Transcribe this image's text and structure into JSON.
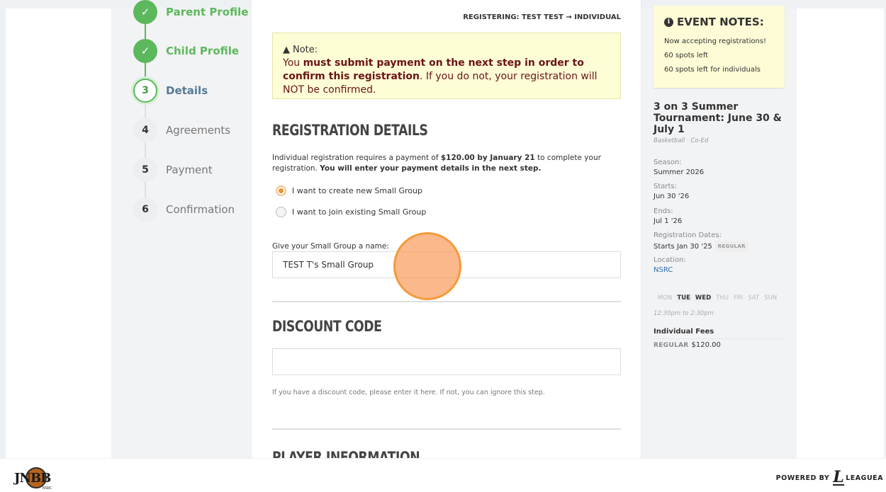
{
  "steps": [
    {
      "num": "✓",
      "label": "Parent Profile",
      "state": "done"
    },
    {
      "num": "✓",
      "label": "Child Profile",
      "state": "done"
    },
    {
      "num": "3",
      "label": "Details",
      "state": "current"
    },
    {
      "num": "4",
      "label": "Agreements",
      "state": "todo"
    },
    {
      "num": "5",
      "label": "Payment",
      "state": "todo"
    },
    {
      "num": "6",
      "label": "Confirmation",
      "state": "todo"
    }
  ],
  "main": {
    "registering": "REGISTERING: TEST TEST → INDIVIDUAL",
    "note": {
      "title": "Note:",
      "prefix": "You ",
      "bold": "must submit payment on the next step in order to confirm this registration",
      "suffix": ". If you do not, your registration will NOT be confirmed."
    },
    "registration_details": {
      "heading": "REGISTRATION DETAILS",
      "desc_1": "Individual registration requires a payment of ",
      "amount": "$120.00 by January 21",
      "desc_2": " to complete your registration. ",
      "desc_bold": "You will enter your payment details in the next step.",
      "option_create": "I want to create new Small Group",
      "option_join": "I want to join existing Small Group",
      "group_name_label": "Give your Small Group a name:",
      "group_name_value": "TEST T's Small Group"
    },
    "discount": {
      "heading": "DISCOUNT CODE",
      "value": "",
      "hint": "If you have a discount code, please enter it here. If not, you can ignore this step."
    },
    "player_info_heading": "PLAYER INFORMATION"
  },
  "sidebar": {
    "notes_title": "EVENT NOTES:",
    "notes": [
      "Now accepting registrations!",
      "60 spots left",
      "60 spots left for individuals"
    ],
    "event_title": "3 on 3 Summer Tournament: June 30 & July 1",
    "event_sub": "Basketball · Co-Ed",
    "season_label": "Season:",
    "season_value": "Summer 2026",
    "starts_label": "Starts:",
    "starts_value": "Jun 30 '26",
    "ends_label": "Ends:",
    "ends_value": "Jul 1 '26",
    "regdates_label": "Registration Dates:",
    "regdates_value": "Starts Jan 30 '25",
    "regdates_tag": "REGULAR",
    "location_label": "Location:",
    "location_value": "NSRC",
    "days": [
      "MON",
      "TUE",
      "WED",
      "THU",
      "FRI",
      "SAT",
      "SUN"
    ],
    "time": "12:30pm to 2:30pm",
    "fees_heading": "Individual Fees",
    "fees_label": "REGULAR",
    "fees_value": "$120.00"
  },
  "footer": {
    "logo_text": "JNBB",
    "logo_sub": "NSRC",
    "powered_by": "POWERED BY",
    "powered_brand": "LEAGUEA"
  },
  "colors": {
    "accent_green": "#5cb85c",
    "accent_orange": "#f0902a",
    "note_bg": "#fdfdd6",
    "link_blue": "#2a6eb0"
  }
}
